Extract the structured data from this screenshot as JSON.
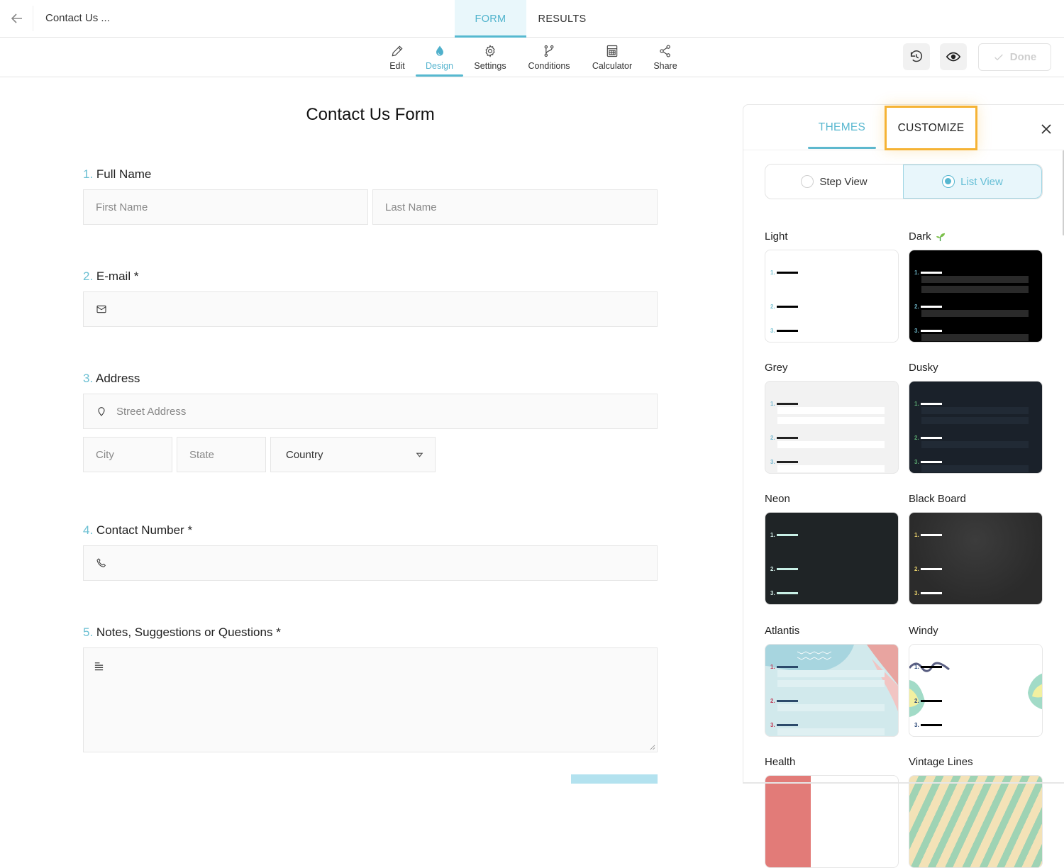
{
  "header": {
    "doc_title": "Contact Us ...",
    "tabs": [
      {
        "label": "FORM",
        "active": true
      },
      {
        "label": "RESULTS",
        "active": false
      }
    ]
  },
  "toolbar": {
    "tools": [
      {
        "label": "Edit",
        "icon": "pencil-icon"
      },
      {
        "label": "Design",
        "icon": "droplet-icon",
        "active": true
      },
      {
        "label": "Settings",
        "icon": "gear-icon"
      },
      {
        "label": "Conditions",
        "icon": "branch-icon"
      },
      {
        "label": "Calculator",
        "icon": "calculator-icon"
      },
      {
        "label": "Share",
        "icon": "share-icon"
      }
    ],
    "done_label": "Done"
  },
  "form": {
    "title": "Contact Us Form",
    "questions": [
      {
        "num": "1.",
        "label": "Full Name",
        "required": "",
        "fields": [
          {
            "placeholder": "First Name"
          },
          {
            "placeholder": "Last Name"
          }
        ]
      },
      {
        "num": "2.",
        "label": "E-mail",
        "required": "*",
        "icon": "mail-icon"
      },
      {
        "num": "3.",
        "label": "Address",
        "required": "",
        "fields": [
          {
            "placeholder": "Street Address",
            "icon": "location-pin-icon"
          },
          {
            "placeholder": "City"
          },
          {
            "placeholder": "State"
          },
          {
            "value": "Country",
            "type": "select"
          }
        ]
      },
      {
        "num": "4.",
        "label": "Contact Number",
        "required": "*",
        "icon": "phone-icon"
      },
      {
        "num": "5.",
        "label": "Notes, Suggestions or Questions",
        "required": "*",
        "icon": "text-lines-icon"
      }
    ]
  },
  "panel": {
    "tabs": [
      {
        "label": "THEMES",
        "active": true
      },
      {
        "label": "CUSTOMIZE",
        "highlighted": true
      }
    ],
    "view_options": [
      {
        "label": "Step View",
        "selected": false
      },
      {
        "label": "List View",
        "selected": true
      }
    ],
    "themes": [
      {
        "name": "Light"
      },
      {
        "name": "Dark",
        "badge": "sprout-icon"
      },
      {
        "name": "Grey"
      },
      {
        "name": "Dusky"
      },
      {
        "name": "Neon"
      },
      {
        "name": "Black Board"
      },
      {
        "name": "Atlantis"
      },
      {
        "name": "Windy"
      },
      {
        "name": "Health"
      },
      {
        "name": "Vintage Lines"
      }
    ]
  },
  "colors": {
    "accent": "#56b9d0",
    "highlight": "#f5b335"
  }
}
